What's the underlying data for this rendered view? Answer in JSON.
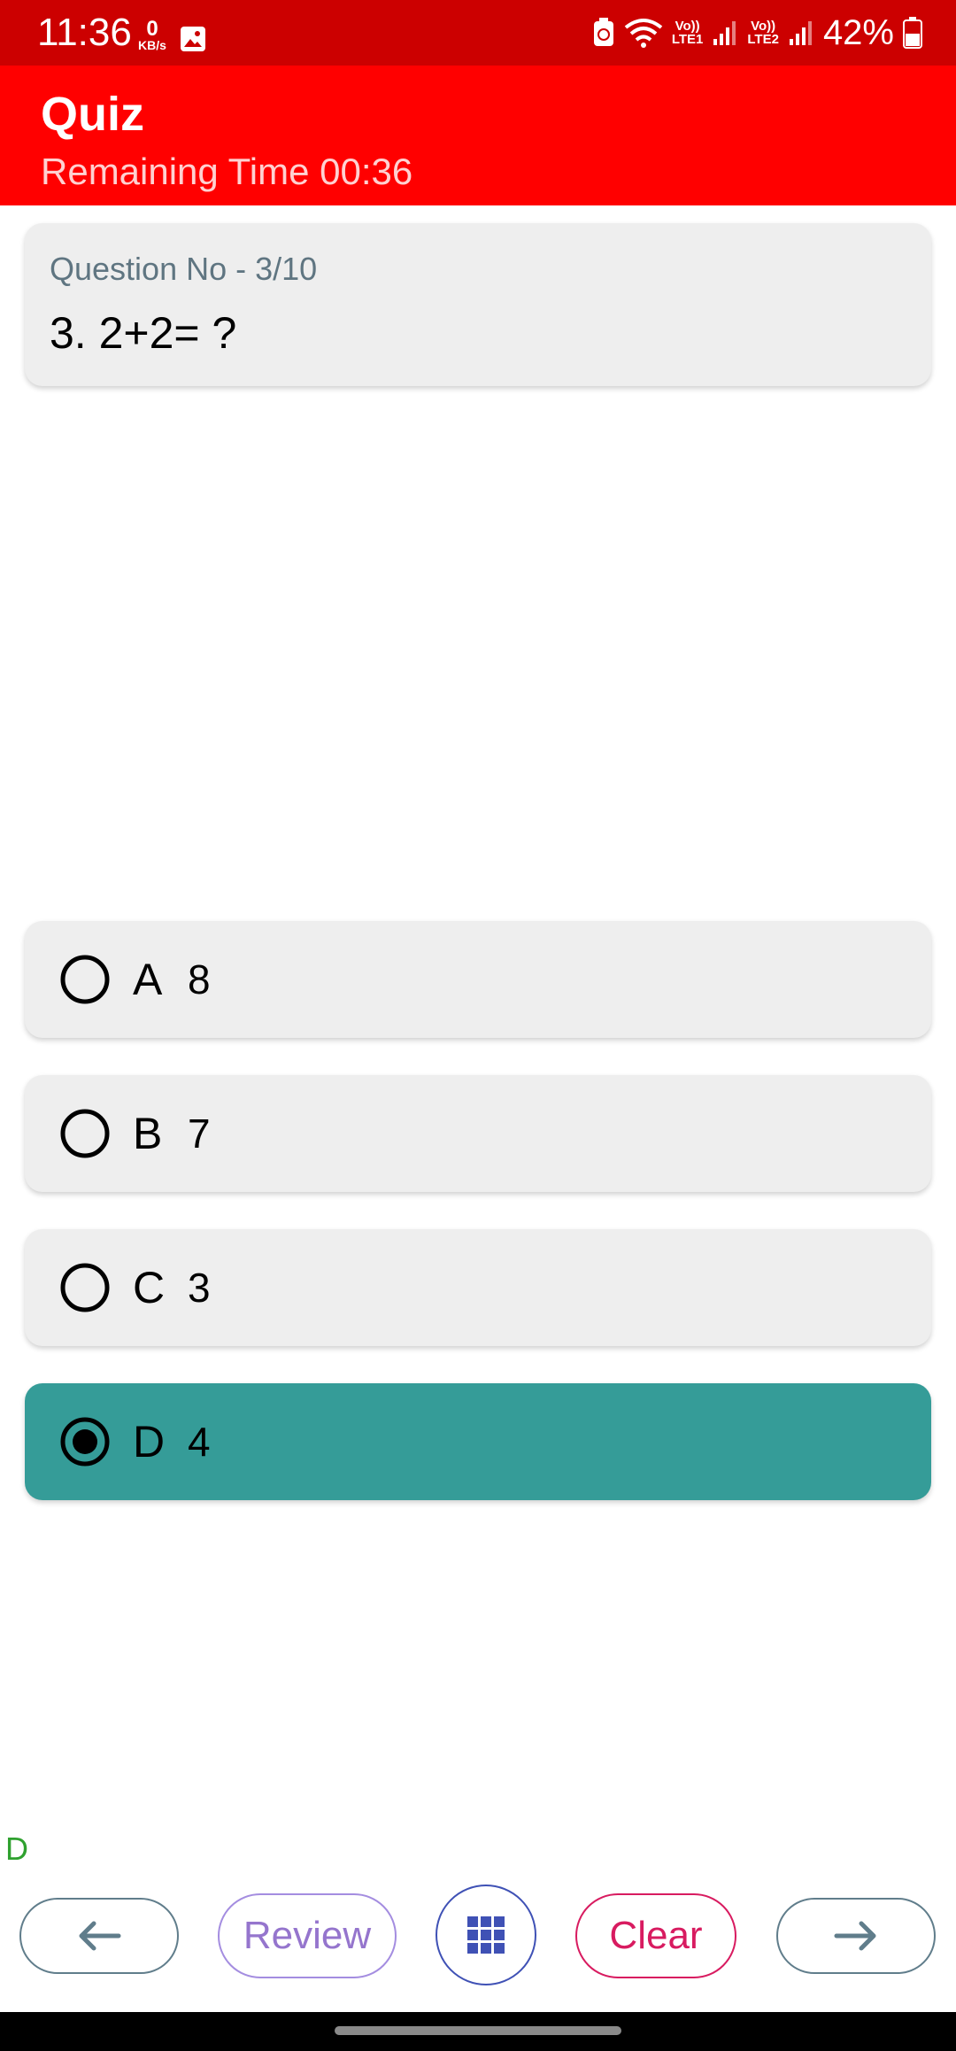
{
  "status_bar": {
    "time": "11:36",
    "net_speed_value": "0",
    "net_speed_unit": "KB/s",
    "sim1_label_top": "Vo))",
    "sim1_label_bottom": "LTE1",
    "sim2_label_top": "Vo))",
    "sim2_label_bottom": "LTE2",
    "battery_percent": "42%",
    "icons": [
      "gallery-icon",
      "battery-saver-icon",
      "wifi-icon",
      "signal-icon",
      "signal-icon",
      "battery-icon"
    ]
  },
  "app_bar": {
    "title": "Quiz",
    "timer": "Remaining Time 00:36"
  },
  "question": {
    "number_label": "Question No - 3/10",
    "text": "3. 2+2= ?"
  },
  "options": [
    {
      "letter": "A",
      "value": "8",
      "selected": false
    },
    {
      "letter": "B",
      "value": "7",
      "selected": false
    },
    {
      "letter": "C",
      "value": "3",
      "selected": false
    },
    {
      "letter": "D",
      "value": "4",
      "selected": true
    }
  ],
  "selected_answer": "D",
  "buttons": {
    "prev_icon": "arrow-left-icon",
    "review_label": "Review",
    "grid_icon": "grid-icon",
    "clear_label": "Clear",
    "next_icon": "arrow-right-icon"
  },
  "colors": {
    "status_bar": "#cc0000",
    "app_bar": "#ff0000",
    "selected_option": "#359c98",
    "option_bg": "#eeeeee",
    "review": "#9575cd",
    "clear": "#d81b60",
    "grid": "#3f51b5",
    "selected_answer_text": "#2fa12f"
  }
}
